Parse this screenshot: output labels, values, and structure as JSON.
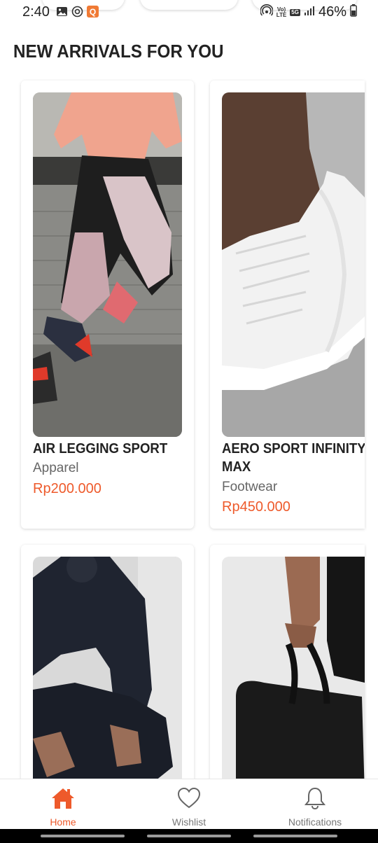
{
  "status_bar": {
    "time": "2:40",
    "battery": "46%",
    "quick_app_letter": "Q",
    "network_top": "Vo)",
    "network_bottom": "LTE",
    "network_type": "5G"
  },
  "section": {
    "title": "NEW ARRIVALS FOR YOU"
  },
  "products": [
    {
      "name": "AIR LEGGING SPORT",
      "category": "Apparel",
      "price": "Rp200.000"
    },
    {
      "name_line1": "AERO SPORT INFINITY",
      "name_line2": "MAX",
      "category": "Footwear",
      "price": "Rp450.000"
    }
  ],
  "bottom_nav": {
    "items": [
      {
        "label": "Home",
        "icon": "home-icon",
        "active": true
      },
      {
        "label": "Wishlist",
        "icon": "heart-icon",
        "active": false
      },
      {
        "label": "Notifications",
        "icon": "bell-icon",
        "active": false
      }
    ]
  },
  "colors": {
    "accent": "#ee5a2b",
    "text_dark": "#222222",
    "text_muted": "#666666",
    "nav_inactive": "#777777"
  }
}
